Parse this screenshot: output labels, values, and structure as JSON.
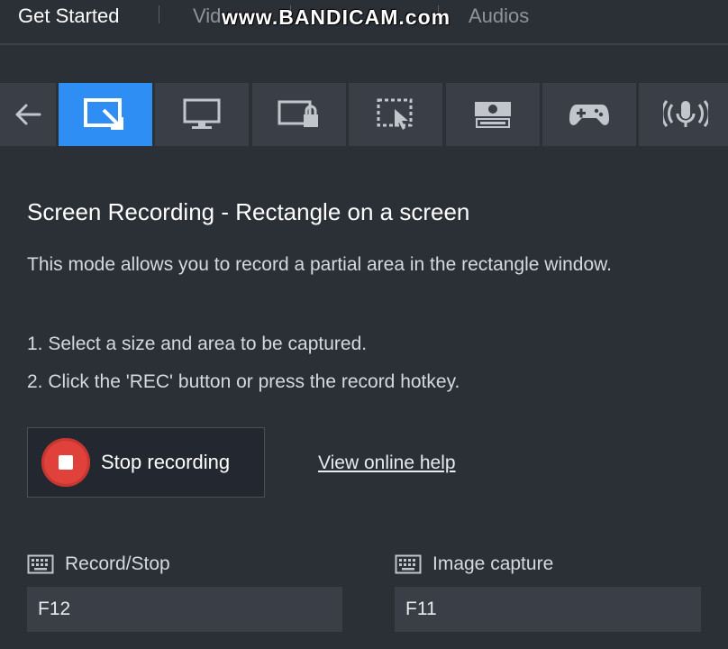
{
  "topnav": {
    "tabs": [
      {
        "label": "Get Started"
      },
      {
        "label": "Vid"
      },
      {
        "label": "Audios"
      }
    ],
    "watermark": "www.BANDICAM.com"
  },
  "modes": [
    {
      "name": "back",
      "icon": "arrow-left-icon"
    },
    {
      "name": "rectangle",
      "icon": "rectangle-area-icon",
      "active": true
    },
    {
      "name": "fullscreen",
      "icon": "monitor-icon"
    },
    {
      "name": "locked-window",
      "icon": "window-lock-icon"
    },
    {
      "name": "around-mouse",
      "icon": "dashed-area-cursor-icon"
    },
    {
      "name": "device",
      "icon": "hdmi-device-icon"
    },
    {
      "name": "game",
      "icon": "gamepad-icon"
    },
    {
      "name": "audio",
      "icon": "microphone-icon"
    }
  ],
  "content": {
    "heading": "Screen Recording - Rectangle on a screen",
    "description": "This mode allows you to record a partial area in the rectangle window.",
    "step1": "1. Select a size and area to be captured.",
    "step2": "2. Click the 'REC' button or press the record hotkey.",
    "record_button_label": "Stop recording",
    "help_link": "View online help"
  },
  "hotkeys": {
    "record_stop": {
      "label": "Record/Stop",
      "value": "F12"
    },
    "image_capture": {
      "label": "Image capture",
      "value": "F11"
    }
  },
  "colors": {
    "background": "#2b2f36",
    "accent": "#2f8ef4",
    "record": "#e0413a"
  }
}
